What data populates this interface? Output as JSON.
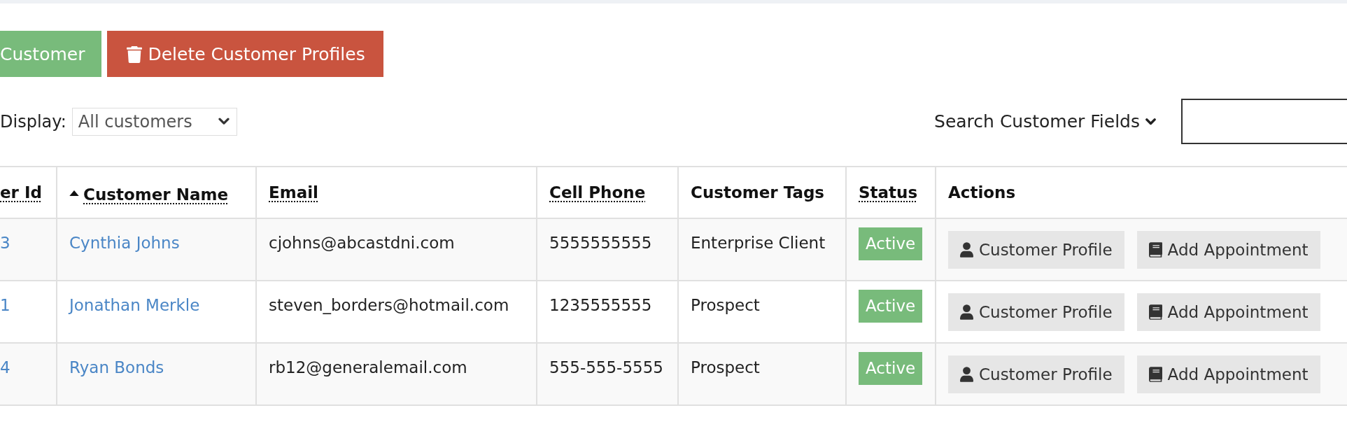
{
  "toolbar": {
    "buttons": [
      {
        "label": "Customer",
        "kind": "add"
      },
      {
        "label": "Delete Customer Profiles",
        "kind": "delete"
      }
    ]
  },
  "filters": {
    "display": {
      "label": "Display:",
      "value": "All customers"
    },
    "search": {
      "label": "Search Customer Fields"
    }
  },
  "table": {
    "columns": [
      {
        "label": "er Id",
        "sortable": true,
        "sorted": false
      },
      {
        "label": "Customer Name",
        "sortable": true,
        "sorted": true
      },
      {
        "label": "Email",
        "sortable": true,
        "sorted": false
      },
      {
        "label": "Cell Phone",
        "sortable": true,
        "sorted": false
      },
      {
        "label": "Customer Tags",
        "sortable": false,
        "sorted": false
      },
      {
        "label": "Status",
        "sortable": true,
        "sorted": false
      },
      {
        "label": "Actions",
        "sortable": false,
        "sorted": false
      }
    ],
    "rows": [
      {
        "id": "3",
        "name": "Cynthia Johns",
        "email": "cjohns@abcastdni.com",
        "cell_phone": "5555555555",
        "tags": "Enterprise Client",
        "status": {
          "label": "Active",
          "kind": "active"
        },
        "actions": [
          {
            "label": "Customer Profile",
            "kind": "profile"
          },
          {
            "label": "Add Appointment",
            "kind": "appointment"
          }
        ]
      },
      {
        "id": "1",
        "name": "Jonathan Merkle",
        "email": "steven_borders@hotmail.com",
        "cell_phone": "1235555555",
        "tags": "Prospect",
        "status": {
          "label": "Active",
          "kind": "active"
        },
        "actions": [
          {
            "label": "Customer Profile",
            "kind": "profile"
          },
          {
            "label": "Add Appointment",
            "kind": "appointment"
          }
        ]
      },
      {
        "id": "4",
        "name": "Ryan Bonds",
        "email": "rb12@generalemail.com",
        "cell_phone": "555-555-5555",
        "tags": "Prospect",
        "status": {
          "label": "Active",
          "kind": "active"
        },
        "actions": [
          {
            "label": "Customer Profile",
            "kind": "profile"
          },
          {
            "label": "Add Appointment",
            "kind": "appointment"
          }
        ]
      }
    ]
  }
}
